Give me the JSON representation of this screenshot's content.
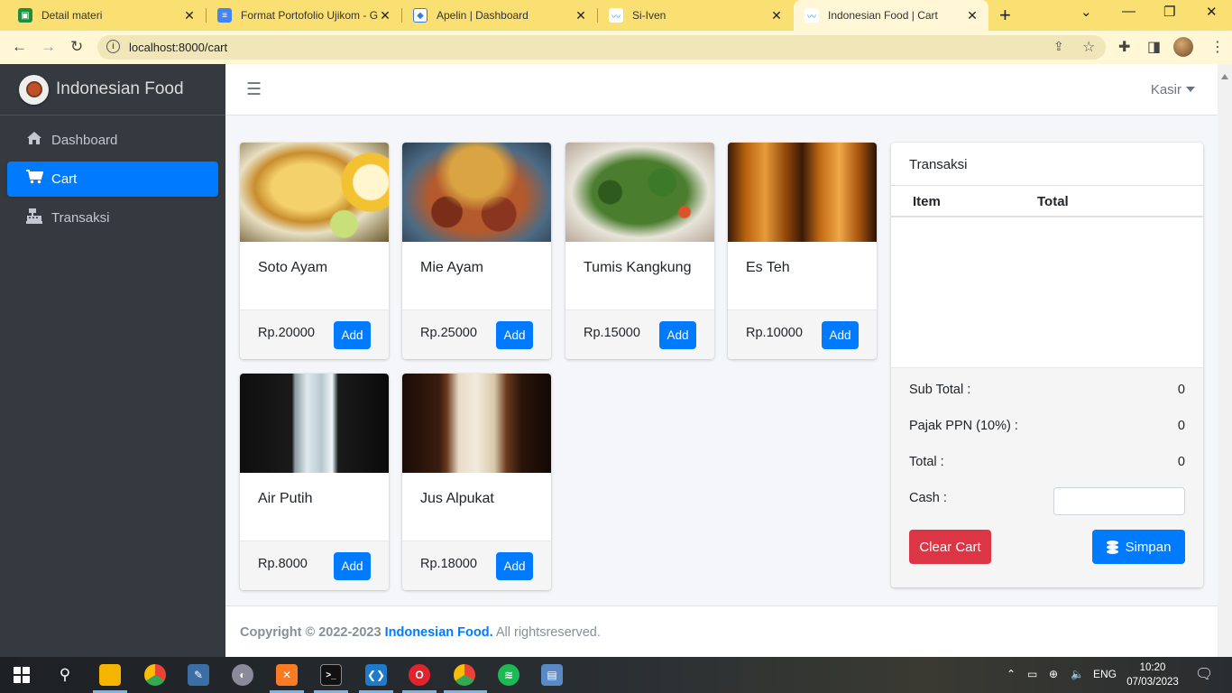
{
  "browser": {
    "tabs": [
      {
        "title": "Detail materi",
        "icon": "classroom-icon",
        "color": "#1e8e3e"
      },
      {
        "title": "Format Portofolio Ujikom - G",
        "icon": "docs-icon",
        "color": "#4285f4"
      },
      {
        "title": "Apelin | Dashboard",
        "icon": "apelin-icon",
        "color": "#3a7bd5"
      },
      {
        "title": "Si-Iven",
        "icon": "wave-icon",
        "color": "#2a9df4"
      },
      {
        "title": "Indonesian Food | Cart",
        "icon": "wave-icon",
        "color": "#2a9df4"
      }
    ],
    "url": "localhost:8000/cart"
  },
  "sidebar": {
    "brand": "Indonesian Food",
    "items": [
      {
        "label": "Dashboard",
        "icon": "home-icon"
      },
      {
        "label": "Cart",
        "icon": "cart-icon"
      },
      {
        "label": "Transaksi",
        "icon": "cash-register-icon"
      }
    ]
  },
  "header": {
    "user": "Kasir"
  },
  "products": [
    {
      "name": "Soto Ayam",
      "price": "Rp.20000",
      "add": "Add"
    },
    {
      "name": "Mie Ayam",
      "price": "Rp.25000",
      "add": "Add"
    },
    {
      "name": "Tumis Kangkung",
      "price": "Rp.15000",
      "add": "Add"
    },
    {
      "name": "Es Teh",
      "price": "Rp.10000",
      "add": "Add"
    },
    {
      "name": "Air Putih",
      "price": "Rp.8000",
      "add": "Add"
    },
    {
      "name": "Jus Alpukat",
      "price": "Rp.18000",
      "add": "Add"
    }
  ],
  "transaksi": {
    "title": "Transaksi",
    "col_item": "Item",
    "col_total": "Total",
    "subtotal_label": "Sub Total :",
    "subtotal_value": "0",
    "ppn_label": "Pajak PPN (10%) :",
    "ppn_value": "0",
    "total_label": "Total :",
    "total_value": "0",
    "cash_label": "Cash :",
    "cash_value": "",
    "clear_label": "Clear Cart",
    "save_label": "Simpan"
  },
  "footer": {
    "copyright": "Copyright © 2022-2023",
    "brand": "Indonesian Food.",
    "rights": "All rightsreserved."
  },
  "taskbar": {
    "lang": "ENG",
    "time": "10:20",
    "date": "07/03/2023"
  },
  "colors": {
    "primary": "#007bff",
    "danger": "#dc3545",
    "sidebar": "#343a40",
    "chrome": "#fadf72"
  }
}
